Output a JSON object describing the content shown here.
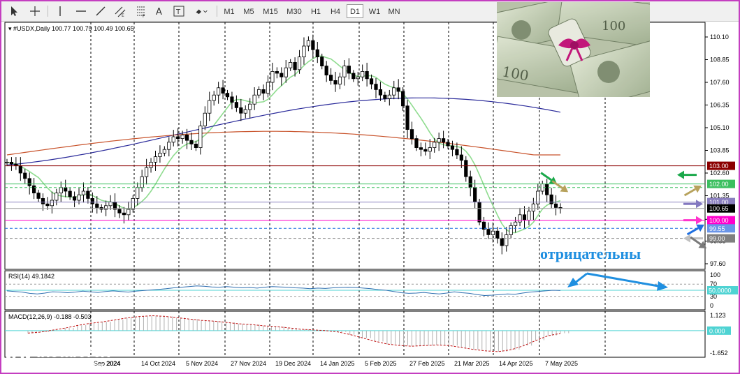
{
  "toolbar": {
    "timeframes": [
      "M1",
      "M5",
      "M15",
      "M30",
      "H1",
      "H4",
      "D1",
      "W1",
      "MN"
    ],
    "active": "D1",
    "tools": [
      "cursor-icon",
      "crosshair-icon",
      "vertical-line-icon",
      "horizontal-line-icon",
      "trendline-icon",
      "equidistant-channel-icon",
      "fibonacci-icon",
      "text-icon",
      "text-label-icon",
      "shapes-icon"
    ]
  },
  "chart_data": {
    "type": "candlestick",
    "symbol": "#USDX,Daily",
    "ohlc_header": "100.77 100.79 100.49 100.65",
    "price_axis": {
      "min": 97.6,
      "max": 110.6,
      "ticks": [
        "110.10",
        "108.85",
        "107.60",
        "106.35",
        "105.10",
        "103.85",
        "102.60",
        "101.35",
        "100.05",
        "98.85",
        "97.60"
      ]
    },
    "date_labels": [
      "Sep 2024",
      "14 Oct 2024",
      "5 Nov 2024",
      "27 Nov 2024",
      "19 Dec 2024",
      "14 Jan 2025",
      "5 Feb 2025",
      "27 Feb 2025",
      "21 Mar 2025",
      "14 Apr 2025",
      "7 May 2025"
    ],
    "date_label_visible": "2024",
    "closes": [
      103.2,
      103.1,
      103.0,
      102.6,
      102.3,
      101.9,
      101.5,
      101.2,
      100.9,
      100.8,
      101.1,
      101.5,
      101.8,
      101.6,
      101.3,
      101.1,
      101.4,
      101.6,
      101.2,
      100.9,
      100.7,
      100.6,
      100.8,
      101.0,
      100.6,
      100.4,
      100.3,
      100.6,
      101.2,
      101.8,
      102.4,
      102.9,
      103.2,
      103.5,
      103.7,
      103.9,
      104.3,
      104.6,
      104.5,
      104.7,
      104.4,
      104.2,
      104.0,
      105.2,
      105.9,
      106.6,
      106.9,
      107.3,
      107.0,
      106.8,
      106.5,
      106.2,
      105.9,
      106.1,
      106.4,
      106.9,
      107.2,
      107.0,
      107.6,
      108.2,
      108.1,
      107.9,
      108.4,
      108.7,
      108.3,
      109.0,
      109.6,
      109.9,
      109.4,
      109.0,
      108.5,
      108.0,
      107.7,
      107.5,
      107.9,
      108.5,
      108.1,
      107.8,
      107.9,
      108.2,
      107.8,
      107.5,
      107.2,
      106.9,
      106.7,
      106.9,
      107.3,
      107.1,
      106.3,
      105.0,
      104.5,
      104.0,
      103.9,
      103.8,
      104.0,
      104.3,
      104.5,
      104.3,
      104.1,
      103.9,
      103.6,
      103.3,
      102.4,
      101.8,
      101.0,
      99.9,
      99.5,
      99.2,
      99.4,
      99.0,
      98.6,
      99.2,
      99.7,
      99.9,
      100.3,
      100.0,
      100.5,
      100.9,
      101.6,
      102.0,
      101.4,
      100.9,
      100.7,
      100.65
    ],
    "moving_averages": [
      {
        "color": "#8fdc8f",
        "kind": "fast"
      },
      {
        "color": "#2a2a9a",
        "kind": "medium"
      },
      {
        "color": "#c8522a",
        "kind": "slow"
      }
    ],
    "levels": [
      {
        "price": 103.0,
        "label": "103.00",
        "color": "#8b0000",
        "label_bg": "#8b0000",
        "style": "solid"
      },
      {
        "price": 102.0,
        "label": "102.00",
        "color": "#3bbf5f",
        "label_bg": "#3bbf5f",
        "style": "solid"
      },
      {
        "price": 101.8,
        "label": "",
        "color": "#3bbf5f",
        "label_bg": "",
        "style": "dashed"
      },
      {
        "price": 101.0,
        "label": "101.00",
        "color": "#8a7fbf",
        "label_bg": "#8a7fbf",
        "style": "solid"
      },
      {
        "price": 100.65,
        "label": "100.65",
        "color": "#9a9a9a",
        "label_bg": "#000000",
        "style": "solid"
      },
      {
        "price": 100.0,
        "label": "100.00",
        "color": "#ff00cc",
        "label_bg": "#ff00cc",
        "style": "solid"
      },
      {
        "price": 99.55,
        "label": "99.55",
        "color": "#1f6fe0",
        "label_bg": "#6a95e8",
        "style": "dashed"
      },
      {
        "price": 99.0,
        "label": "99.00",
        "color": "#8a8a8a",
        "label_bg": "#7f7f7f",
        "style": "dashed"
      }
    ],
    "arrows": [
      {
        "color": "#1aa84a",
        "price": 102.5,
        "direction": "left"
      },
      {
        "color": "#b7a25c",
        "price": 101.6,
        "direction": "up-right"
      },
      {
        "color": "#8378c0",
        "price": 100.9,
        "direction": "right"
      },
      {
        "color": "#ff33cc",
        "price": 100.0,
        "direction": "right"
      },
      {
        "color": "#1f6fe0",
        "price": 99.45,
        "direction": "up-right"
      },
      {
        "color": "#c0c0c0",
        "price": 99.0,
        "direction": "left"
      },
      {
        "color": "#7a7a7a",
        "price": 98.8,
        "direction": "down-right"
      }
    ],
    "rsi": {
      "label": "RSI(14) 49.1842",
      "ticks": [
        "100",
        "70",
        "30",
        "0"
      ],
      "level_tag": "50.0000",
      "values": [
        48,
        46,
        44,
        40,
        38,
        41,
        45,
        44,
        42,
        44,
        47,
        45,
        43,
        46,
        48,
        46,
        44,
        47,
        49,
        51,
        53,
        55,
        58,
        60,
        62,
        64,
        63,
        61,
        60,
        62,
        60,
        58,
        59,
        57,
        60,
        62,
        61,
        60,
        58,
        57,
        55,
        57,
        56,
        58,
        59,
        60,
        59,
        57,
        55,
        52,
        50,
        46,
        42,
        40,
        41,
        43,
        40,
        38,
        41,
        45,
        42,
        40,
        36,
        33,
        34,
        36,
        38,
        37,
        41,
        44,
        46,
        48,
        50,
        49
      ]
    },
    "macd": {
      "label": "MACD(12,26,9) -0.188 -0.503",
      "ticks": [
        "1.123",
        "0.000",
        "-1.652"
      ],
      "zero_tag": "0.000",
      "values": [
        -0.2,
        -0.1,
        0.05,
        0.2,
        0.4,
        0.55,
        0.65,
        0.8,
        0.95,
        1.05,
        1.1,
        1.05,
        0.95,
        0.85,
        0.75,
        0.7,
        0.6,
        0.5,
        0.45,
        0.35,
        0.3,
        0.2,
        0.1,
        0.05,
        0.0,
        -0.1,
        -0.3,
        -0.55,
        -0.8,
        -1.0,
        -1.1,
        -1.15,
        -1.1,
        -1.05,
        -1.1,
        -1.25,
        -1.4,
        -1.5,
        -1.55,
        -1.4,
        -1.1,
        -0.7,
        -0.35,
        -0.19
      ]
    }
  },
  "annotation": {
    "text": "отрицательны"
  },
  "logo": {
    "name": "instaforex",
    "tagline": "Instant Forex Trading"
  }
}
